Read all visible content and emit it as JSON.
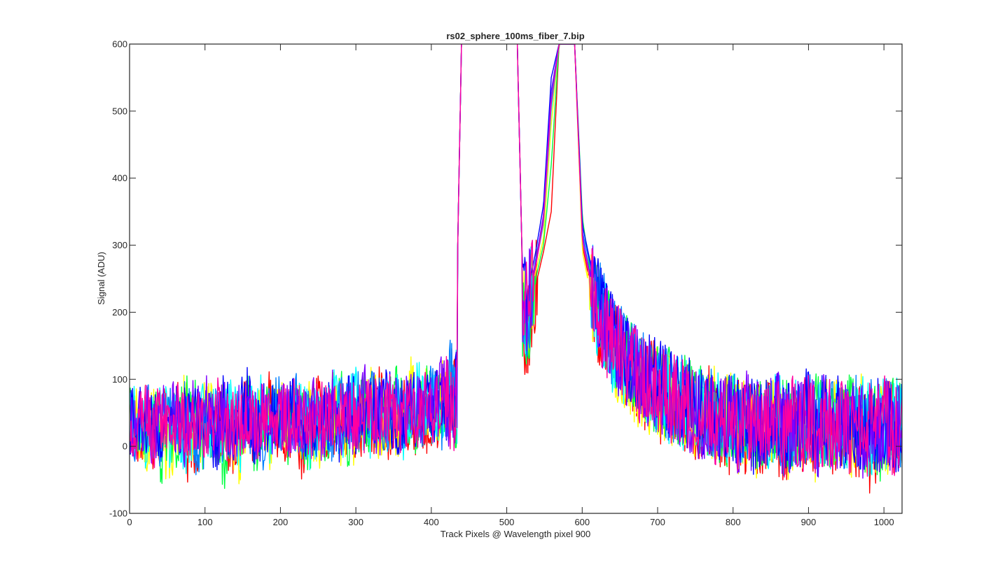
{
  "chart_data": {
    "type": "line",
    "title": "rs02_sphere_100ms_fiber_7.bip",
    "xlabel": "Track Pixels @ Wavelength pixel 900",
    "ylabel": "Signal (ADU)",
    "xlim": [
      0,
      1024
    ],
    "ylim": [
      -100,
      600
    ],
    "xticks": [
      0,
      100,
      200,
      300,
      400,
      500,
      600,
      700,
      800,
      900,
      1000
    ],
    "yticks": [
      -100,
      0,
      100,
      200,
      300,
      400,
      500,
      600
    ],
    "x_range_of_samples": [
      1,
      1024
    ],
    "gap_above_ylim": [
      441,
      514
    ],
    "grid": false,
    "legend": "none",
    "series": [
      {
        "color": "#ff0000",
        "values": [
          30,
          12,
          45,
          -5,
          38,
          22,
          60,
          8,
          -20,
          35,
          50,
          15,
          42,
          -10,
          28,
          55,
          18,
          33,
          70,
          5,
          25,
          48,
          -15,
          40,
          62,
          20,
          35,
          10,
          58,
          30,
          45,
          22,
          75,
          15,
          40,
          68,
          28,
          50,
          35,
          60,
          42,
          90,
          55,
          72,
          65,
          88,
          110,
          95,
          150,
          130,
          185,
          170,
          240,
          290,
          350,
          600,
          null,
          600,
          300,
          240,
          180,
          150,
          160,
          120,
          110,
          95,
          80,
          100,
          70,
          65,
          80,
          50,
          55,
          45,
          60,
          30,
          40,
          25,
          50,
          20,
          35,
          15,
          45,
          28,
          10,
          38,
          20,
          42,
          18,
          30,
          5,
          25,
          40,
          12,
          35,
          -8,
          28,
          45,
          20,
          32
        ]
      },
      {
        "color": "#ffff00",
        "values": [
          20,
          35,
          10,
          48,
          25,
          -12,
          40,
          55,
          18,
          30,
          62,
          8,
          45,
          28,
          -5,
          50,
          22,
          38,
          15,
          60,
          32,
          48,
          20,
          55,
          10,
          38,
          65,
          25,
          45,
          12,
          50,
          70,
          30,
          55,
          22,
          40,
          80,
          48,
          62,
          35,
          75,
          58,
          95,
          70,
          85,
          110,
          100,
          135,
          125,
          170,
          210,
          195,
          260,
          310,
          480,
          600,
          null,
          600,
          290,
          230,
          200,
          160,
          140,
          130,
          115,
          100,
          90,
          85,
          75,
          80,
          60,
          70,
          50,
          62,
          40,
          55,
          30,
          48,
          22,
          45,
          15,
          38,
          28,
          50,
          10,
          32,
          20,
          45,
          12,
          38,
          25,
          48,
          15,
          30,
          42,
          8,
          35,
          22,
          50,
          28
        ]
      },
      {
        "color": "#00ff40",
        "values": [
          40,
          15,
          28,
          55,
          -8,
          35,
          20,
          48,
          62,
          12,
          30,
          45,
          -15,
          38,
          25,
          58,
          10,
          42,
          30,
          65,
          18,
          50,
          35,
          8,
          55,
          28,
          45,
          70,
          15,
          40,
          60,
          25,
          50,
          35,
          72,
          45,
          58,
          30,
          80,
          52,
          68,
          85,
          60,
          95,
          78,
          105,
          120,
          110,
          145,
          160,
          200,
          185,
          250,
          300,
          420,
          600,
          null,
          600,
          340,
          260,
          210,
          170,
          150,
          140,
          120,
          110,
          100,
          90,
          80,
          85,
          65,
          70,
          55,
          60,
          45,
          50,
          35,
          42,
          55,
          20,
          40,
          30,
          48,
          15,
          35,
          25,
          50,
          10,
          42,
          28,
          38,
          18,
          45,
          30,
          20,
          40,
          12,
          35,
          48,
          25
        ]
      },
      {
        "color": "#00ffff",
        "values": [
          25,
          48,
          10,
          32,
          58,
          20,
          42,
          -2,
          35,
          68,
          15,
          40,
          22,
          55,
          8,
          45,
          30,
          62,
          12,
          38,
          50,
          25,
          60,
          18,
          42,
          30,
          75,
          20,
          48,
          65,
          35,
          28,
          58,
          40,
          70,
          32,
          55,
          78,
          42,
          65,
          50,
          88,
          72,
          58,
          98,
          82,
          115,
          100,
          140,
          155,
          190,
          210,
          270,
          330,
          500,
          600,
          null,
          600,
          310,
          250,
          190,
          175,
          145,
          135,
          125,
          105,
          95,
          88,
          82,
          70,
          75,
          58,
          65,
          48,
          55,
          40,
          52,
          32,
          45,
          25,
          40,
          18,
          35,
          50,
          22,
          38,
          28,
          45,
          15,
          40,
          30,
          50,
          20,
          35,
          45,
          15,
          38,
          28,
          42,
          30
        ]
      },
      {
        "color": "#0080ff",
        "values": [
          35,
          18,
          50,
          28,
          12,
          45,
          30,
          60,
          22,
          -5,
          40,
          55,
          18,
          35,
          48,
          25,
          65,
          15,
          38,
          52,
          28,
          70,
          20,
          45,
          35,
          60,
          25,
          50,
          40,
          72,
          30,
          58,
          48,
          20,
          65,
          42,
          80,
          35,
          60,
          72,
          48,
          92,
          65,
          80,
          100,
          88,
          118,
          130,
          150,
          175,
          220,
          200,
          280,
          340,
          520,
          600,
          null,
          600,
          320,
          270,
          215,
          180,
          155,
          142,
          128,
          112,
          102,
          92,
          85,
          78,
          72,
          66,
          58,
          52,
          48,
          44,
          38,
          50,
          30,
          46,
          22,
          42,
          35,
          48,
          18,
          40,
          28,
          52,
          15,
          44,
          32,
          38,
          24,
          46,
          20,
          36,
          30,
          44,
          26,
          34
        ]
      },
      {
        "color": "#0000ff",
        "values": [
          28,
          42,
          15,
          55,
          30,
          8,
          48,
          35,
          62,
          20,
          40,
          12,
          58,
          28,
          45,
          65,
          18,
          38,
          52,
          25,
          42,
          60,
          30,
          15,
          55,
          38,
          48,
          22,
          68,
          40,
          30,
          62,
          45,
          75,
          28,
          52,
          65,
          40,
          82,
          55,
          70,
          48,
          90,
          62,
          85,
          105,
          95,
          125,
          140,
          165,
          205,
          230,
          290,
          360,
          550,
          600,
          null,
          600,
          330,
          275,
          220,
          185,
          160,
          148,
          130,
          118,
          105,
          95,
          88,
          80,
          72,
          68,
          60,
          55,
          50,
          45,
          40,
          52,
          32,
          48,
          25,
          44,
          36,
          50,
          20,
          42,
          30,
          55,
          18,
          46,
          34,
          40,
          26,
          48,
          22,
          38,
          32,
          46,
          28,
          36
        ]
      },
      {
        "color": "#8000ff",
        "values": [
          22,
          38,
          52,
          18,
          40,
          28,
          55,
          12,
          45,
          32,
          60,
          25,
          48,
          15,
          38,
          58,
          30,
          42,
          20,
          65,
          35,
          48,
          28,
          55,
          42,
          18,
          62,
          35,
          50,
          28,
          70,
          45,
          38,
          60,
          52,
          32,
          75,
          48,
          65,
          55,
          85,
          60,
          78,
          92,
          70,
          108,
          98,
          122,
          138,
          160,
          198,
          215,
          275,
          345,
          530,
          600,
          null,
          600,
          315,
          255,
          205,
          172,
          152,
          138,
          122,
          108,
          98,
          88,
          80,
          74,
          68,
          62,
          56,
          50,
          46,
          42,
          36,
          48,
          28,
          44,
          22,
          40,
          32,
          46,
          18,
          38,
          26,
          50,
          14,
          42,
          30,
          36,
          22,
          44,
          18,
          34,
          28,
          42,
          24,
          32
        ]
      },
      {
        "color": "#ff00a0",
        "values": [
          32,
          25,
          40,
          18,
          45,
          30,
          52,
          22,
          38,
          48,
          28,
          55,
          20,
          42,
          35,
          50,
          25,
          45,
          38,
          58,
          30,
          48,
          40,
          28,
          52,
          35,
          45,
          55,
          30,
          50,
          42,
          62,
          38,
          55,
          48,
          35,
          68,
          45,
          58,
          52,
          78,
          55,
          70,
          85,
          68,
          100,
          92,
          118,
          132,
          155,
          192,
          208,
          268,
          335,
          510,
          600,
          null,
          600,
          305,
          248,
          200,
          168,
          148,
          135,
          120,
          105,
          95,
          86,
          78,
          72,
          66,
          60,
          54,
          48,
          44,
          40,
          35,
          46,
          26,
          42,
          20,
          38,
          30,
          44,
          16,
          36,
          24,
          48,
          12,
          40,
          28,
          34,
          20,
          42,
          16,
          32,
          26,
          40,
          22,
          30
        ]
      }
    ]
  }
}
